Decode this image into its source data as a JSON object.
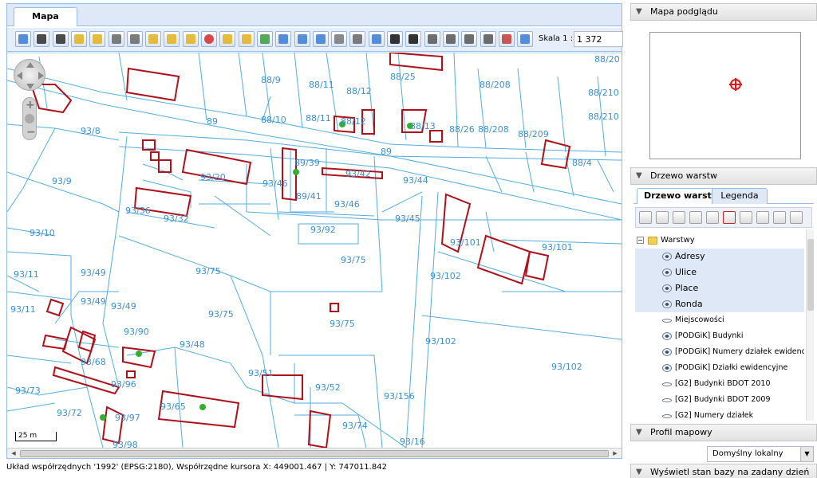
{
  "main": {
    "tab_label": "Mapa",
    "scale_label": "Skala 1 :",
    "scale_value": "1 372",
    "scalebar_label": "25 m"
  },
  "status": {
    "text": "Układ współrzędnych '1992' (EPSG:2180), Współrzędne kursora X: 449001.467 | Y: 747011.842"
  },
  "map": {
    "line_color": "#52aee0",
    "building_color": "#b0101a",
    "label_color": "#3a8fd6",
    "parcel_labels": [
      "88/20",
      "88/9",
      "88/11",
      "88/12",
      "88/25",
      "88/208",
      "88/210",
      "88/10",
      "88/11",
      "88/12",
      "89",
      "88/13",
      "88/26",
      "88/208",
      "88/209",
      "88/210",
      "93/8",
      "89",
      "88/4",
      "89/39",
      "93/42",
      "93/20",
      "93/46",
      "93/44",
      "93/9",
      "89/41",
      "93/46",
      "93/36",
      "93/32",
      "93/45",
      "93/101",
      "93/10",
      "93/92",
      "93/101",
      "93/75",
      "93/11",
      "93/49",
      "93/75",
      "93/102",
      "93/49",
      "93/49",
      "93/11",
      "93/75",
      "93/75",
      "93/90",
      "93/48",
      "93/102",
      "93/68",
      "93/102",
      "93/51",
      "93/96",
      "93/73",
      "93/52",
      "93/156",
      "93/72",
      "93/97",
      "93/65",
      "93/74",
      "93/16",
      "93/98"
    ]
  },
  "right": {
    "preview_title": "Mapa podglądu",
    "layer_title": "Drzewo warstw",
    "tabs": [
      "Drzewo warstw",
      "Legenda"
    ],
    "tree_root": "Warstwy",
    "layers": [
      "Adresy",
      "Ulice",
      "Place",
      "Ronda",
      "Miejscowości",
      "[PODGiK] Budynki",
      "[PODGiK] Numery działek ewidency",
      "[PODGiK] Działki ewidencyjne",
      "[G2] Budynki BDOT 2010",
      "[G2] Budynki BDOT 2009",
      "[G2] Numery działek"
    ],
    "profile_title": "Profil mapowy",
    "profile_value": "Domyślny lokalny",
    "db_title": "Wyświetl stan bazy na zadany dzień"
  }
}
